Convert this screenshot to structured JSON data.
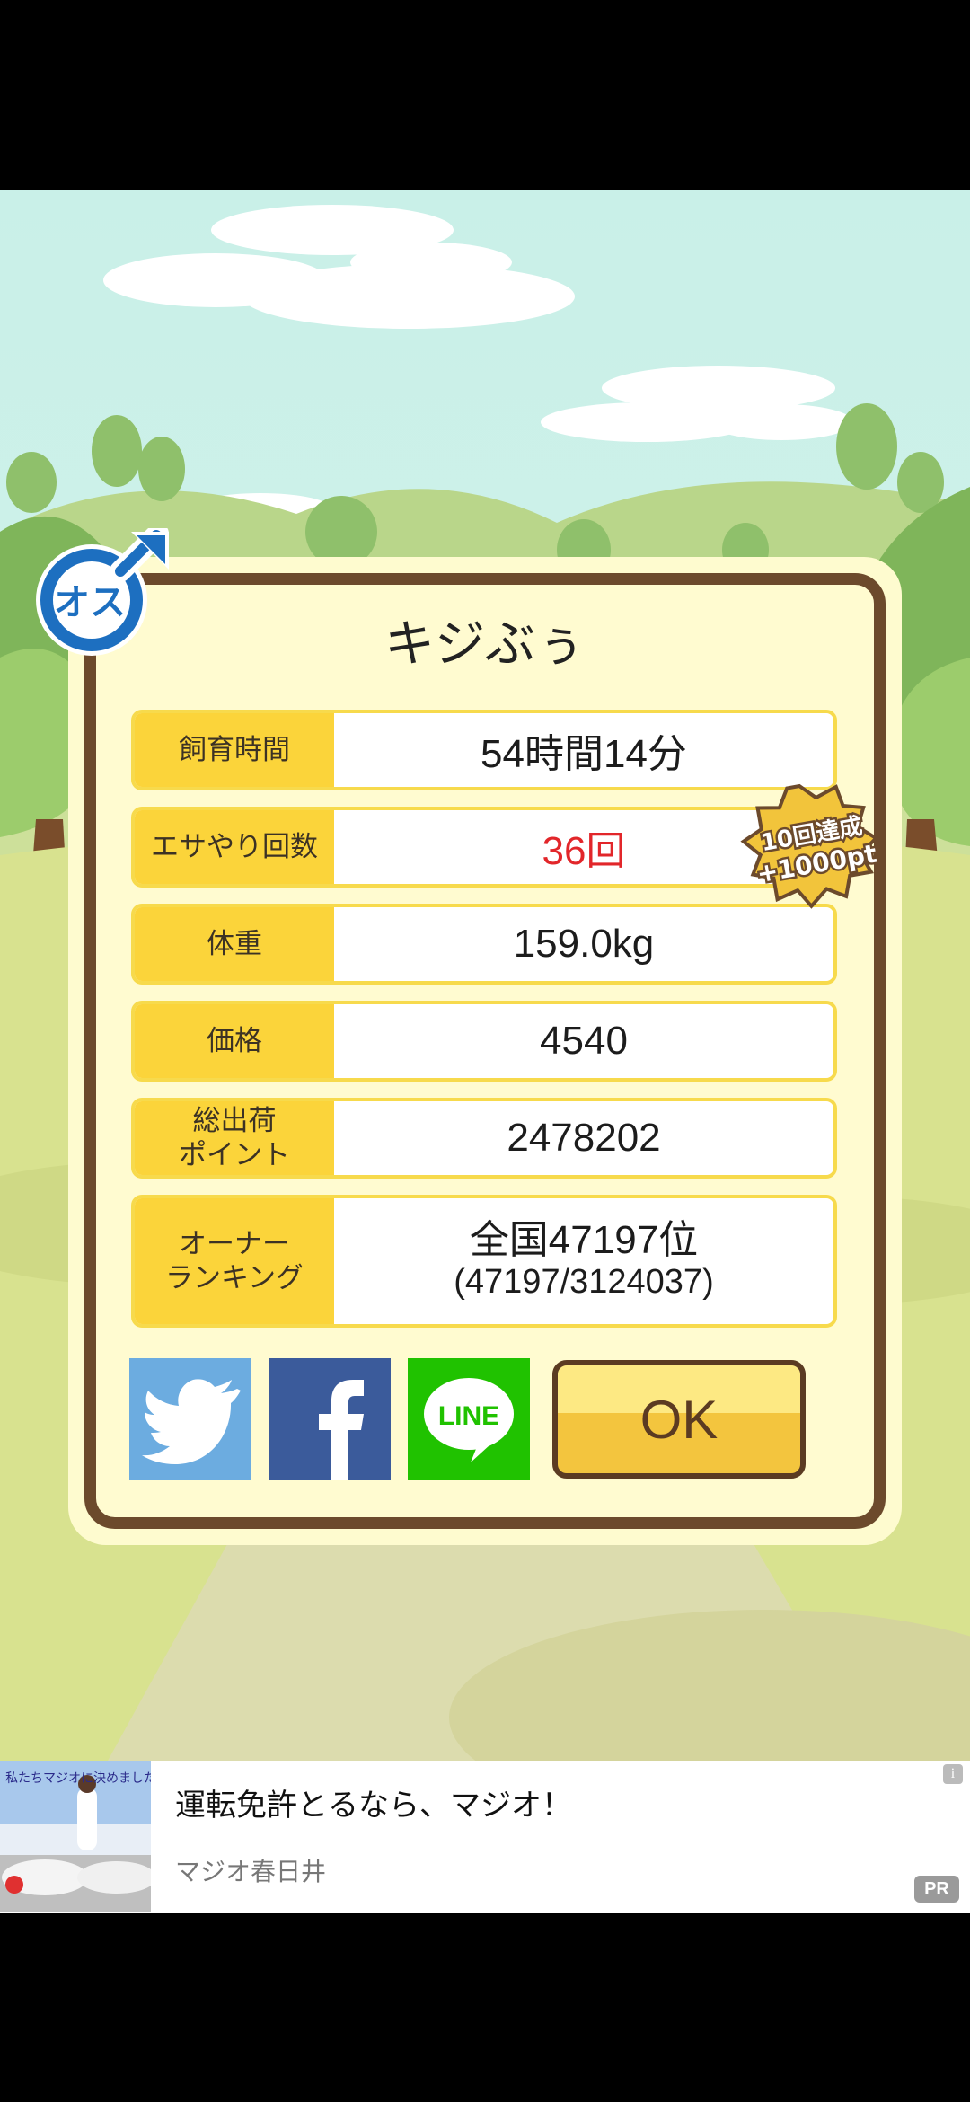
{
  "pet": {
    "name": "キジぶぅ",
    "gender_label": "オス"
  },
  "stats": [
    {
      "label": "飼育時間",
      "value": "54時間14分"
    },
    {
      "label": "エサやり回数",
      "value": "36回"
    },
    {
      "label": "体重",
      "value": "159.0kg"
    },
    {
      "label": "価格",
      "value": "4540"
    },
    {
      "label_line1": "総出荷",
      "label_line2": "ポイント",
      "value": "2478202"
    },
    {
      "label_line1": "オーナー",
      "label_line2": "ランキング",
      "value_line1": "全国47197位",
      "value_line2": "(47197/3124037)"
    }
  ],
  "achievement": {
    "line1": "10回達成",
    "line2": "+1000pt"
  },
  "share": {
    "line_label": "LINE"
  },
  "ok_label": "OK",
  "ad": {
    "title": "運転免許とるなら、マジオ！",
    "subtitle": "マジオ春日井",
    "pr_badge": "PR",
    "info_icon": "i",
    "thumb_text": "私たちマジオに決めました"
  },
  "colors": {
    "panel_border": "#6c4a2c",
    "label_bg": "#fbd43a",
    "highlight_red": "#e2262a",
    "twitter": "#6cace0",
    "facebook": "#3b5b9b",
    "line": "#20c200"
  }
}
